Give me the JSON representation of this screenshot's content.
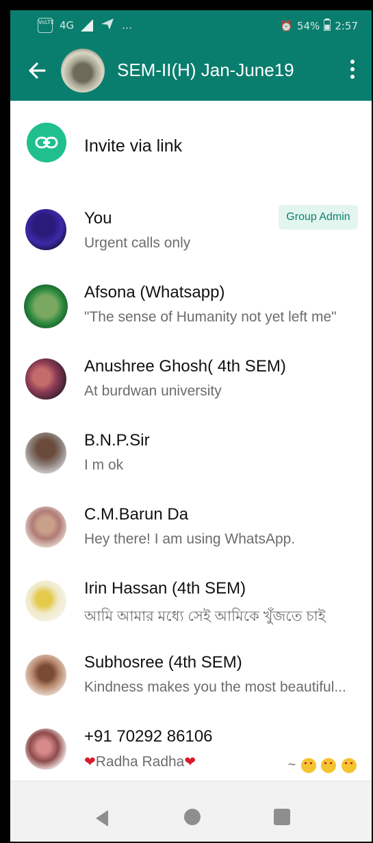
{
  "status_bar": {
    "network": "4G",
    "battery": "54%",
    "time": "2:57"
  },
  "header": {
    "group_name": "SEM-II(H) Jan-June19"
  },
  "invite": {
    "label": "Invite via link"
  },
  "members": [
    {
      "name": "You",
      "status": "Urgent calls only",
      "badge": "Group Admin"
    },
    {
      "name": "Afsona (Whatsapp)",
      "status": "\"The sense of Humanity not yet left me\""
    },
    {
      "name": "Anushree Ghosh( 4th SEM)",
      "status": "At burdwan university"
    },
    {
      "name": "B.N.P.Sir",
      "status": "I m ok"
    },
    {
      "name": "C.M.Barun Da",
      "status": "Hey there! I am using WhatsApp."
    },
    {
      "name": "Irin Hassan (4th SEM)",
      "status": "আমি আমার মধ্যে সেই আমিকে খুঁজতে চাই"
    },
    {
      "name": "Subhosree (4th SEM)",
      "status": "Kindness makes you the most beautiful..."
    },
    {
      "name": "+91 70292 86106",
      "status": "Radha Radha",
      "trailing": "~"
    }
  ],
  "colors": {
    "brand": "#0a7e6e",
    "accent": "#1fbf8e"
  }
}
